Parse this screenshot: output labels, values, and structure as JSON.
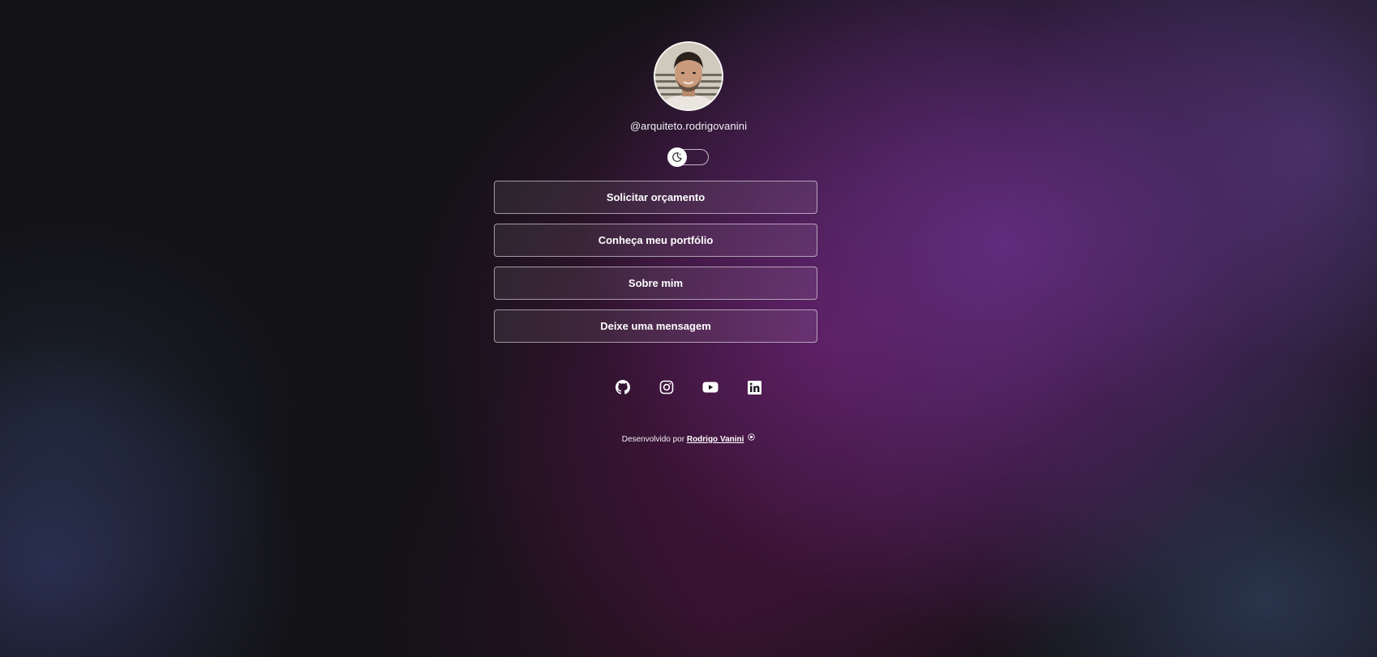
{
  "profile": {
    "username": "@arquiteto.rodrigovanini",
    "avatar_alt": "profile photo"
  },
  "theme_toggle": {
    "icon": "moon-icon",
    "state": "off"
  },
  "links": [
    {
      "label": "Solicitar orçamento"
    },
    {
      "label": "Conheça meu portfólio"
    },
    {
      "label": "Sobre mim"
    },
    {
      "label": "Deixe uma mensagem"
    }
  ],
  "social": [
    {
      "icon": "github-icon"
    },
    {
      "icon": "instagram-icon"
    },
    {
      "icon": "youtube-icon"
    },
    {
      "icon": "linkedin-icon"
    }
  ],
  "footer": {
    "prefix": "Desenvolvido por",
    "author": "Rodrigo Vanini"
  },
  "colors": {
    "background": "#131216",
    "accent_purple": "#70349a",
    "accent_magenta": "#5c1652",
    "text": "#ffffff"
  }
}
